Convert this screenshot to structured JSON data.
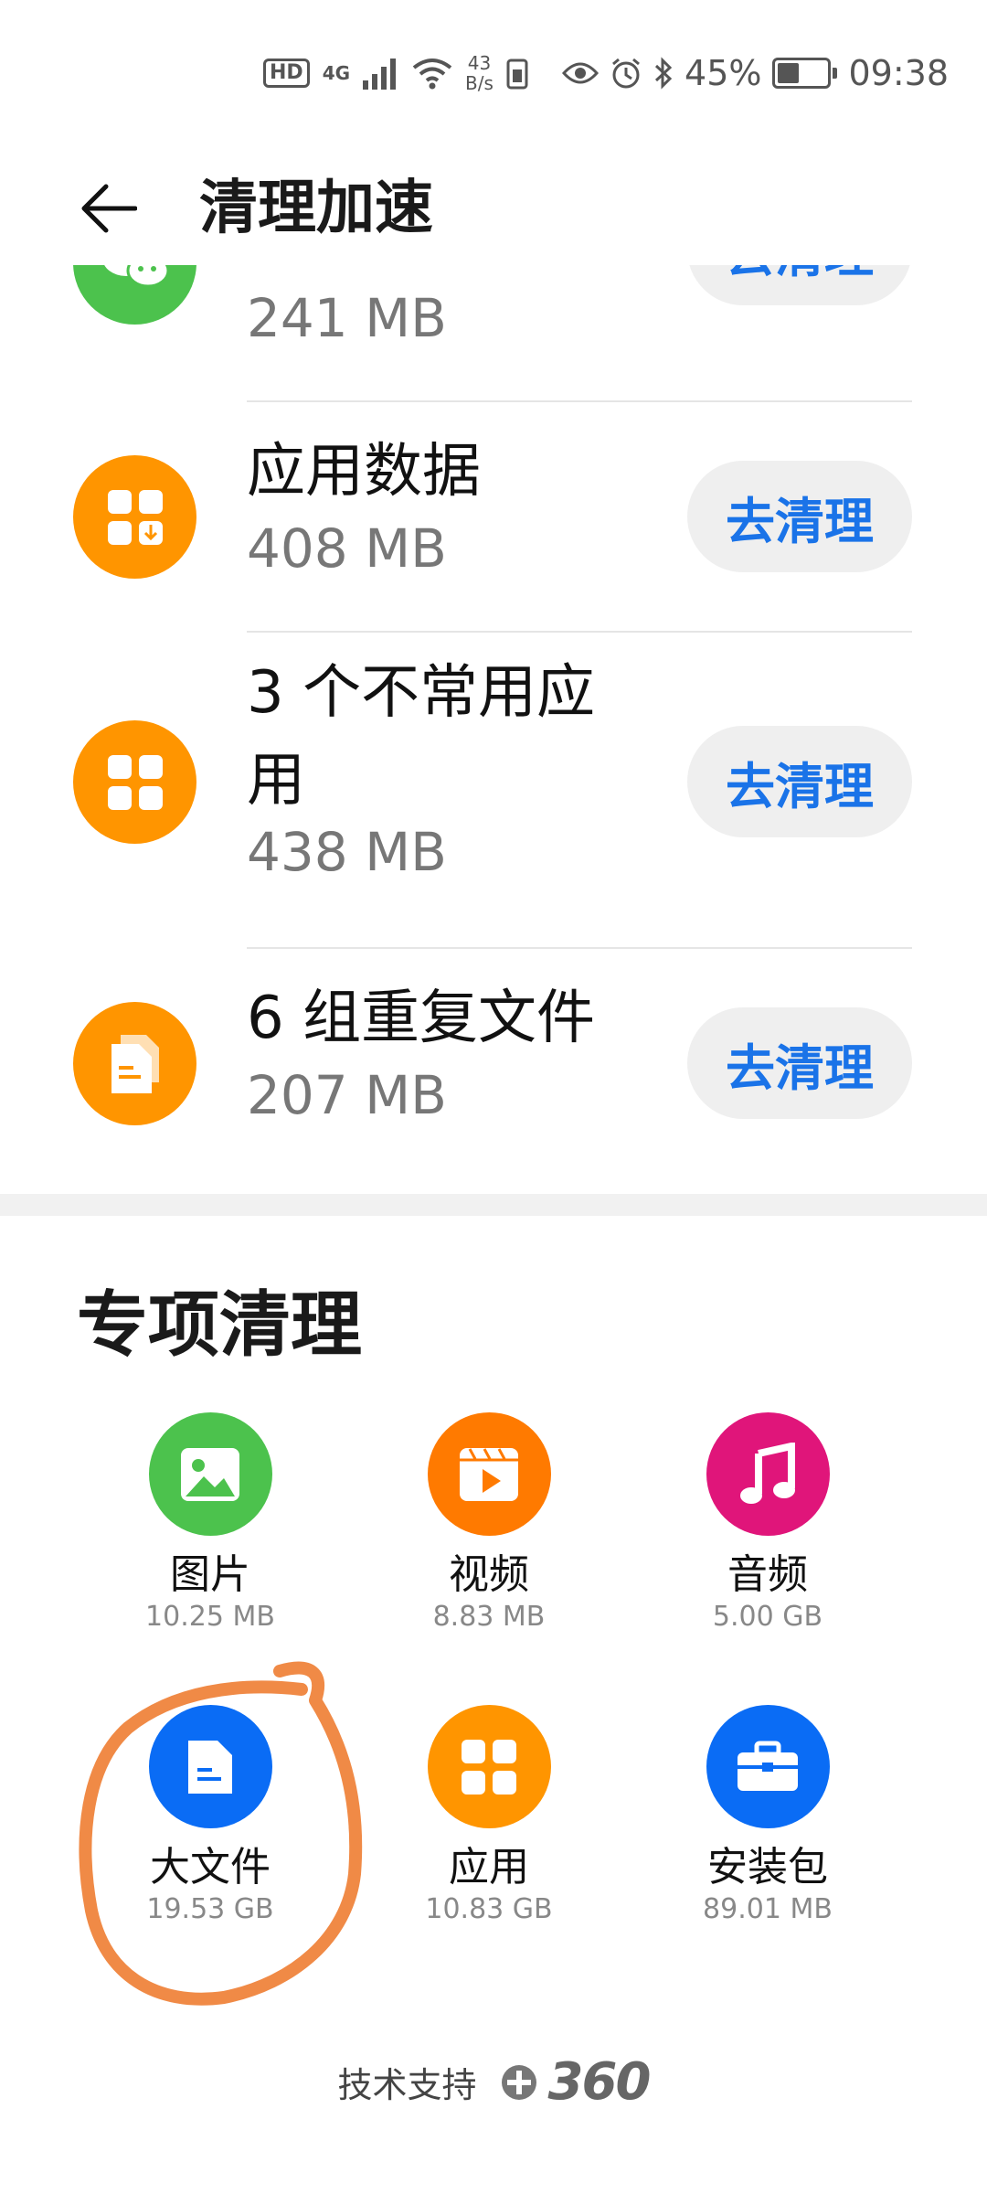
{
  "status_bar": {
    "hd": "HD",
    "network": "4G",
    "speed_value": "43",
    "speed_unit": "B/s",
    "battery": "45%",
    "battery_level": 0.45,
    "time": "09:38"
  },
  "header": {
    "title": "清理加速",
    "back_icon": "back-arrow-icon"
  },
  "list": {
    "partial_item": {
      "size": "241 MB",
      "button": "去清理",
      "icon": "wechat-icon",
      "color": "#4cc24d"
    },
    "items": [
      {
        "name": "应用数据",
        "size": "408 MB",
        "button": "去清理",
        "icon": "app-data-icon",
        "color": "#ff9500"
      },
      {
        "name": "3 个不常用应用",
        "size": "438 MB",
        "button": "去清理",
        "icon": "apps-grid-icon",
        "color": "#ff9500"
      },
      {
        "name": "6 组重复文件",
        "size": "207 MB",
        "button": "去清理",
        "icon": "duplicate-files-icon",
        "color": "#ff9500"
      }
    ]
  },
  "special": {
    "title": "专项清理",
    "items": [
      {
        "label": "图片",
        "size": "10.25 MB",
        "icon": "image-icon",
        "color": "#4cc24d"
      },
      {
        "label": "视频",
        "size": "8.83 MB",
        "icon": "video-icon",
        "color": "#ff7a00"
      },
      {
        "label": "音频",
        "size": "5.00 GB",
        "icon": "music-icon",
        "color": "#e0157a"
      },
      {
        "label": "大文件",
        "size": "19.53 GB",
        "icon": "document-icon",
        "color": "#0a6cf5"
      },
      {
        "label": "应用",
        "size": "10.83 GB",
        "icon": "apps-grid-icon",
        "color": "#ff9500"
      },
      {
        "label": "安装包",
        "size": "89.01 MB",
        "icon": "toolbox-icon",
        "color": "#0a6cf5"
      }
    ]
  },
  "footer": {
    "text": "技术支持",
    "brand": "360"
  },
  "accent_color": "#1a73e8",
  "annotation_color": "#f08a46"
}
